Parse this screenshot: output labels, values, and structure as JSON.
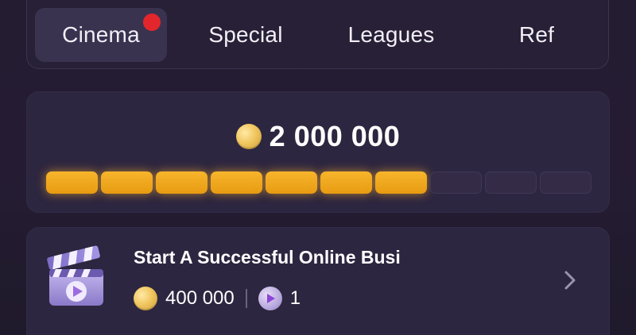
{
  "tabs": [
    {
      "label": "Cinema",
      "active": true,
      "has_notification": true
    },
    {
      "label": "Special",
      "active": false,
      "has_notification": false
    },
    {
      "label": "Leagues",
      "active": false,
      "has_notification": false
    },
    {
      "label": "Ref",
      "active": false,
      "has_notification": false
    }
  ],
  "balance": {
    "icon": "coin-icon",
    "amount": "2 000 000",
    "progress": {
      "filled": 7,
      "total": 10
    }
  },
  "task": {
    "icon": "clapperboard-icon",
    "title": "Start A Successful Online Busi",
    "coin_reward": "400 000",
    "play_reward": "1",
    "action_icon": "chevron-right-icon"
  },
  "colors": {
    "accent_gold": "#f2a623",
    "notification_red": "#e3262c",
    "background": "#241d32",
    "card": "#2d2640"
  }
}
